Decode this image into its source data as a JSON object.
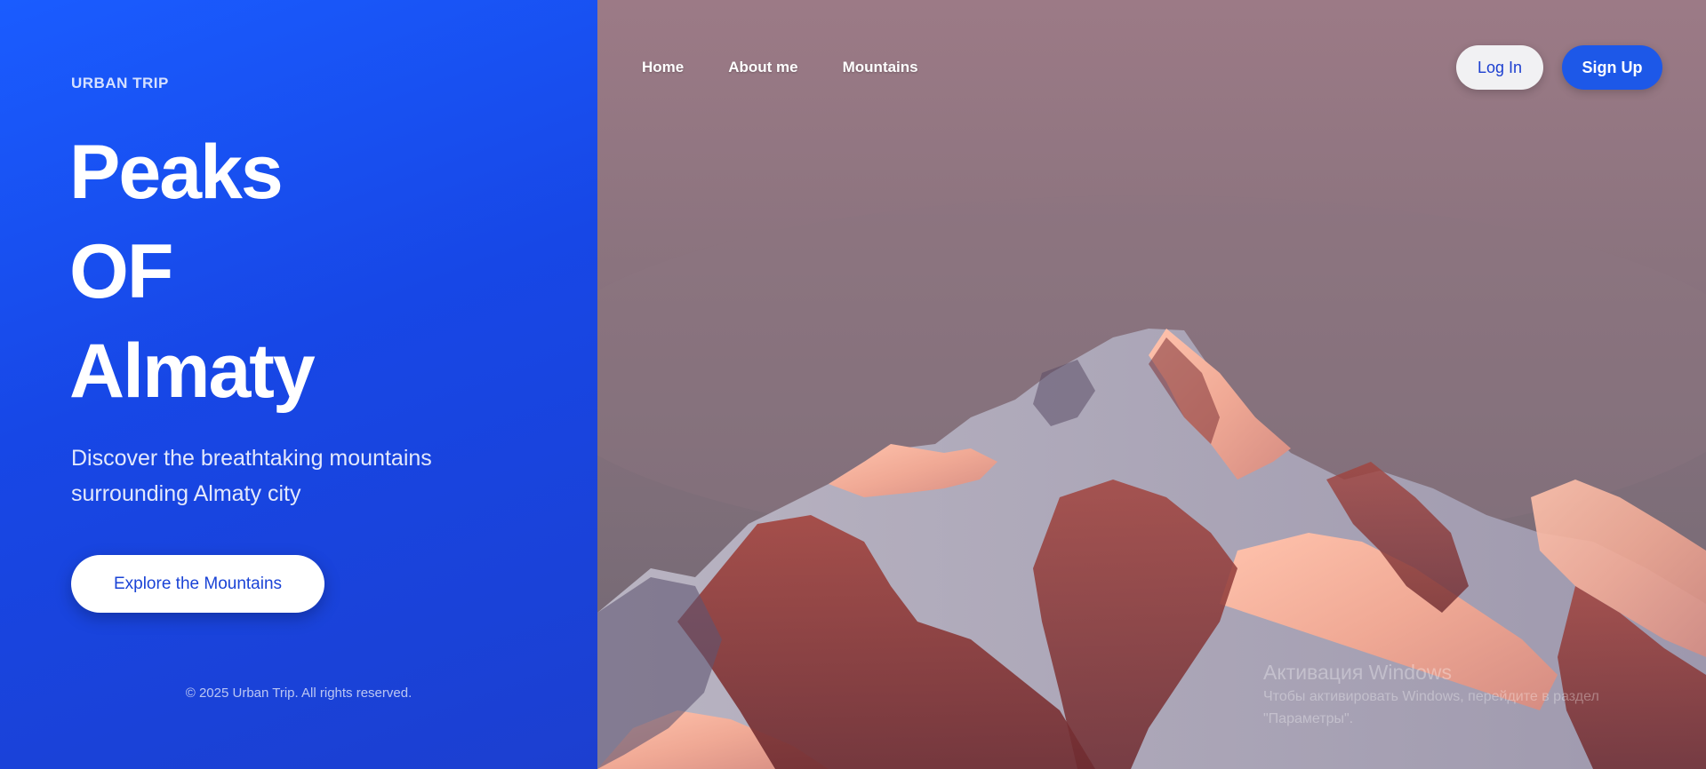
{
  "brand": {
    "name": "URBAN TRIP"
  },
  "hero": {
    "title_lines": [
      "Peaks",
      "OF",
      "Almaty"
    ],
    "subtitle_line1": "Discover the breathtaking mountains",
    "subtitle_line2": "surrounding Almaty city",
    "cta_label": "Explore the Mountains"
  },
  "footer": {
    "text": "© 2025 Urban Trip. All rights reserved."
  },
  "nav": {
    "items": [
      {
        "label": "Home"
      },
      {
        "label": "About me"
      },
      {
        "label": "Mountains"
      }
    ],
    "login_label": "Log In",
    "signup_label": "Sign Up"
  },
  "watermark": {
    "title": "Активация Windows",
    "line1": "Чтобы активировать Windows, перейдите в раздел",
    "line2": "\"Параметры\"."
  },
  "colors": {
    "left_panel": "#1a4de8",
    "accent": "#1d58e8",
    "sky": "#8d7580"
  },
  "image": {
    "subject": "mountain-peak-photo"
  }
}
